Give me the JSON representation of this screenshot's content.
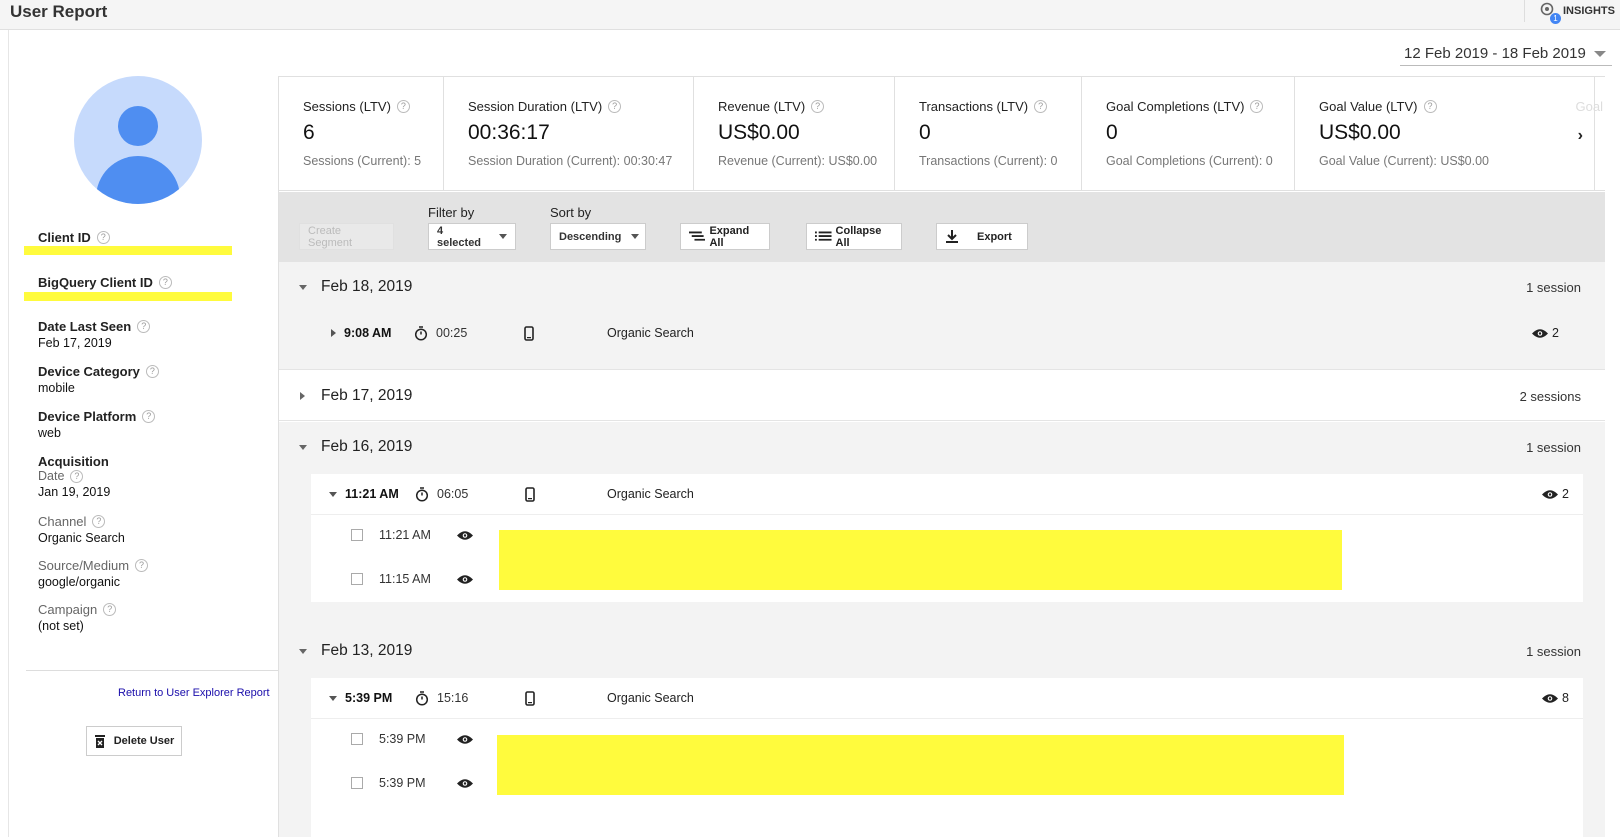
{
  "page": {
    "title": "User Report"
  },
  "insights": {
    "label": "INSIGHTS",
    "badge": "1"
  },
  "date_range": "12 Feb 2019 - 18 Feb 2019",
  "sidebar": {
    "client_id": {
      "label": "Client ID"
    },
    "bigquery_client_id": {
      "label": "BigQuery Client ID"
    },
    "date_last_seen": {
      "label": "Date Last Seen",
      "value": "Feb 17, 2019"
    },
    "device_category": {
      "label": "Device Category",
      "value": "mobile"
    },
    "device_platform": {
      "label": "Device Platform",
      "value": "web"
    },
    "acquisition": {
      "label": "Acquisition"
    },
    "acq_date": {
      "label": "Date",
      "value": "Jan 19, 2019"
    },
    "channel": {
      "label": "Channel",
      "value": "Organic Search"
    },
    "source_medium": {
      "label": "Source/Medium",
      "value": "google/organic"
    },
    "campaign": {
      "label": "Campaign",
      "value": "(not set)"
    },
    "return_link": "Return to User Explorer Report",
    "delete_label": "Delete User"
  },
  "metrics": [
    {
      "label": "Sessions (LTV)",
      "value": "6",
      "current": "Sessions (Current): 5"
    },
    {
      "label": "Session Duration (LTV)",
      "value": "00:36:17",
      "current": "Session Duration (Current): 00:30:47"
    },
    {
      "label": "Revenue (LTV)",
      "value": "US$0.00",
      "current": "Revenue (Current): US$0.00"
    },
    {
      "label": "Transactions (LTV)",
      "value": "0",
      "current": "Transactions (Current): 0"
    },
    {
      "label": "Goal Completions (LTV)",
      "value": "0",
      "current": "Goal Completions (Current): 0"
    },
    {
      "label": "Goal Value (LTV)",
      "value": "US$0.00",
      "current": "Goal Value (Current): US$0.00"
    }
  ],
  "metrics_more": "Goal",
  "toolbar": {
    "create_segment": "Create Segment",
    "filter_label": "Filter by",
    "filter_value": "4 selected",
    "sort_label": "Sort by",
    "sort_value": "Descending",
    "expand_all": "Expand All",
    "collapse_all": "Collapse All",
    "export": "Export"
  },
  "days": [
    {
      "date": "Feb 18, 2019",
      "count": "1 session",
      "sessions": [
        {
          "time": "9:08 AM",
          "duration": "00:25",
          "channel": "Organic Search",
          "views": "2"
        }
      ]
    },
    {
      "date": "Feb 17, 2019",
      "count": "2 sessions"
    },
    {
      "date": "Feb 16, 2019",
      "count": "1 session",
      "sessions": [
        {
          "time": "11:21 AM",
          "duration": "06:05",
          "channel": "Organic Search",
          "views": "2",
          "hits": [
            {
              "time": "11:21 AM"
            },
            {
              "time": "11:15 AM"
            }
          ]
        }
      ]
    },
    {
      "date": "Feb 13, 2019",
      "count": "1 session",
      "sessions": [
        {
          "time": "5:39 PM",
          "duration": "15:16",
          "channel": "Organic Search",
          "views": "8",
          "hits": [
            {
              "time": "5:39 PM"
            },
            {
              "time": "5:39 PM"
            }
          ]
        }
      ]
    }
  ],
  "colors": {
    "highlight": "#fffb3d",
    "avatar_bg": "#c6dafc",
    "avatar_fg": "#4f8ef1",
    "link": "#1a0dab"
  }
}
